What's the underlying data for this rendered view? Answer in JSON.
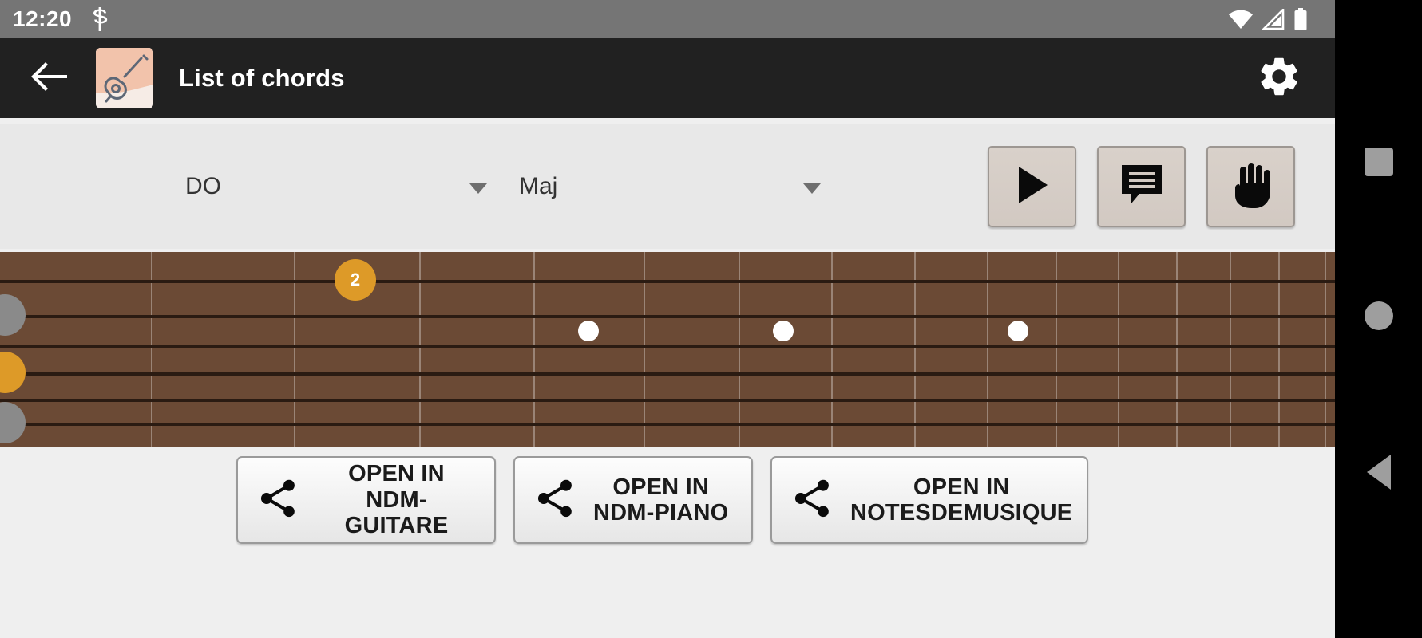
{
  "status_bar": {
    "clock": "12:20",
    "left_icons": [
      "sync-icon"
    ],
    "right_icons": [
      "wifi-icon",
      "cellular-signal-icon",
      "battery-icon"
    ],
    "background_color": "#757575"
  },
  "app_bar": {
    "back_icon": "back-arrow-icon",
    "app_icon": "guitar-app-icon",
    "title": "List of chords",
    "settings_icon": "gear-icon",
    "background_color": "#212121"
  },
  "control_bar": {
    "background_color": "#e8e8e8",
    "note_spinner": {
      "value": "DO",
      "caret_icon": "chevron-down-icon"
    },
    "type_spinner": {
      "value": "Maj",
      "caret_icon": "chevron-down-icon"
    },
    "buttons": [
      {
        "name": "play-button",
        "icon": "play-icon"
      },
      {
        "name": "comment-button",
        "icon": "comment-bubble-icon"
      },
      {
        "name": "hand-button",
        "icon": "hand-icon"
      }
    ]
  },
  "fretboard": {
    "wood_color": "#6b4a35",
    "string_color": "#2a1b12",
    "fret_color": "rgba(255,255,255,0.32)",
    "frets": 12,
    "strings": 6,
    "finger_dot_color": "#dd9a28",
    "muted_dot_color": "#8a8a8a",
    "open_nut_dots": [
      {
        "string": 2,
        "type": "gray",
        "label": ""
      },
      {
        "string": 3,
        "type": "orange",
        "label": ""
      },
      {
        "string": 4,
        "type": "gray",
        "label": ""
      }
    ],
    "pressed_dots": [
      {
        "fret": 3,
        "string": 1,
        "type": "orange",
        "label": "2"
      }
    ],
    "inlay_frets": [
      5,
      7,
      9
    ]
  },
  "share_buttons": [
    {
      "icon": "share-icon",
      "line1": "OPEN IN",
      "line2": "NDM-GUITARE"
    },
    {
      "icon": "share-icon",
      "line1": "OPEN IN",
      "line2": "NDM-PIANO"
    },
    {
      "icon": "share-icon",
      "line1": "OPEN IN",
      "line2": "NOTESDEMUSIQUE"
    }
  ],
  "nav_bar": {
    "background_color": "#000000",
    "keys": [
      {
        "name": "recents-key",
        "icon": "square-icon"
      },
      {
        "name": "home-key",
        "icon": "circle-icon"
      },
      {
        "name": "back-key",
        "icon": "triangle-back-icon"
      }
    ]
  }
}
